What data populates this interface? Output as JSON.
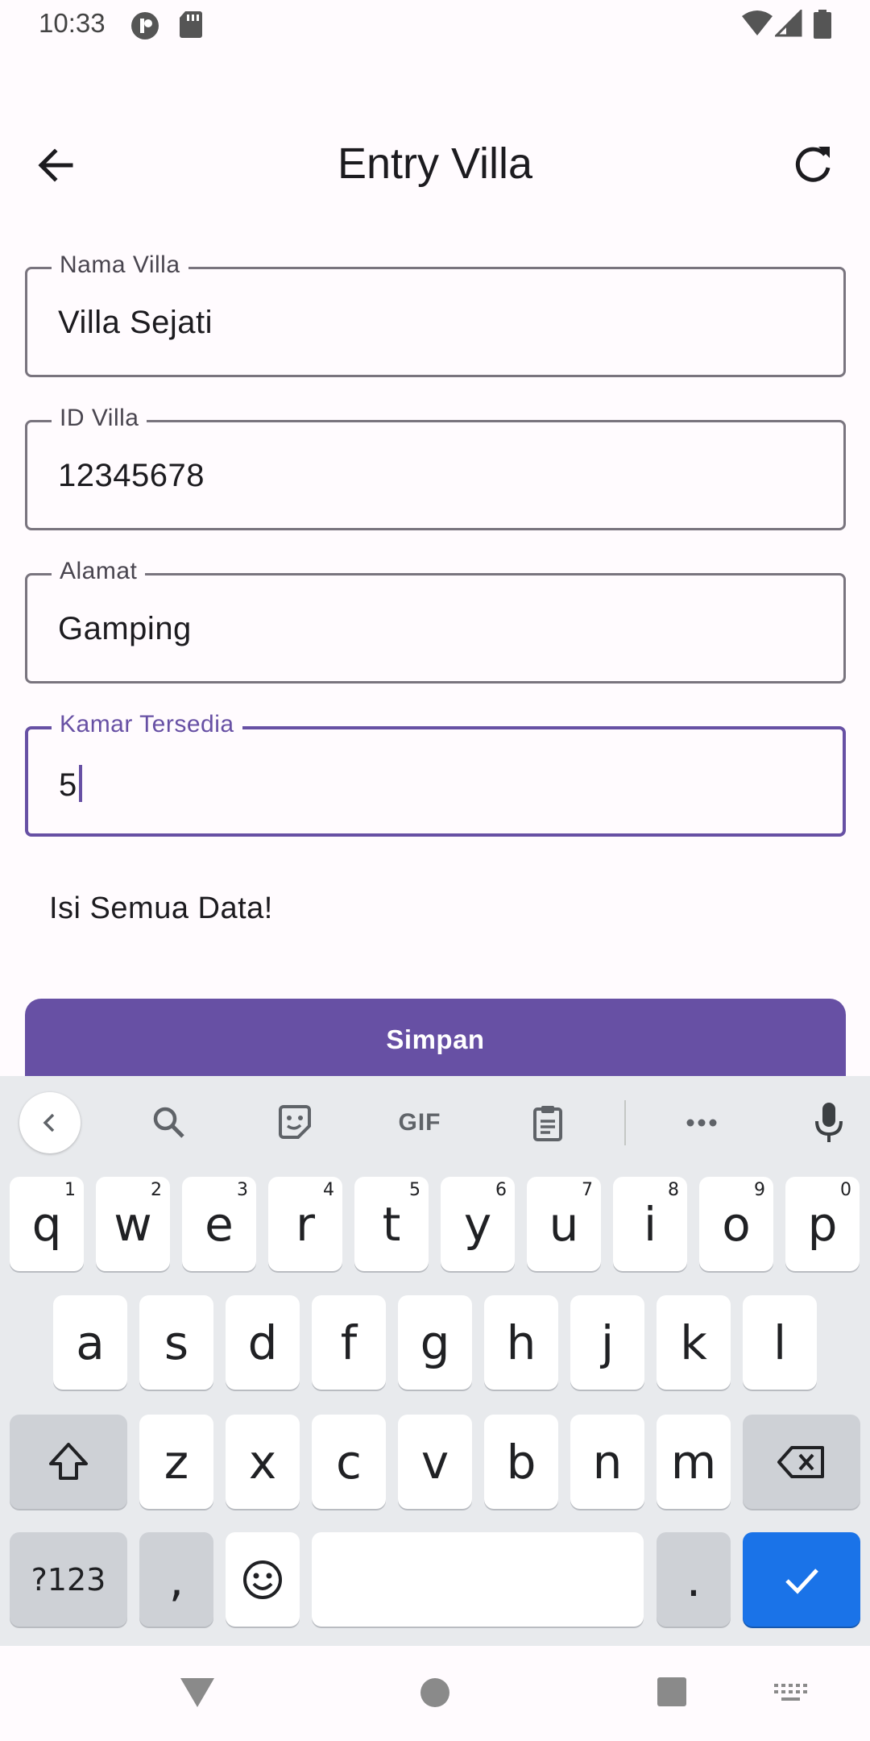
{
  "status_bar": {
    "time": "10:33"
  },
  "app_bar": {
    "title": "Entry Villa",
    "back_icon": "arrow-back-icon",
    "refresh_icon": "refresh-icon"
  },
  "form": {
    "fields": [
      {
        "label": "Nama Villa",
        "value": "Villa Sejati"
      },
      {
        "label": "ID Villa",
        "value": "12345678"
      },
      {
        "label": "Alamat",
        "value": "Gamping"
      },
      {
        "label": "Kamar Tersedia",
        "value": "5"
      }
    ],
    "message": "Isi Semua Data!",
    "save_label": "Simpan"
  },
  "keyboard": {
    "toolbar": {
      "gif_label": "GIF"
    },
    "row1": [
      {
        "key": "q",
        "hint": "1"
      },
      {
        "key": "w",
        "hint": "2"
      },
      {
        "key": "e",
        "hint": "3"
      },
      {
        "key": "r",
        "hint": "4"
      },
      {
        "key": "t",
        "hint": "5"
      },
      {
        "key": "y",
        "hint": "6"
      },
      {
        "key": "u",
        "hint": "7"
      },
      {
        "key": "i",
        "hint": "8"
      },
      {
        "key": "o",
        "hint": "9"
      },
      {
        "key": "p",
        "hint": "0"
      }
    ],
    "row2": [
      "a",
      "s",
      "d",
      "f",
      "g",
      "h",
      "j",
      "k",
      "l"
    ],
    "row3": [
      "z",
      "x",
      "c",
      "v",
      "b",
      "n",
      "m"
    ],
    "symbols_label": "?123",
    "comma": ",",
    "period": "."
  },
  "colors": {
    "primary": "#6750a4",
    "enter_key": "#1a73e8"
  }
}
